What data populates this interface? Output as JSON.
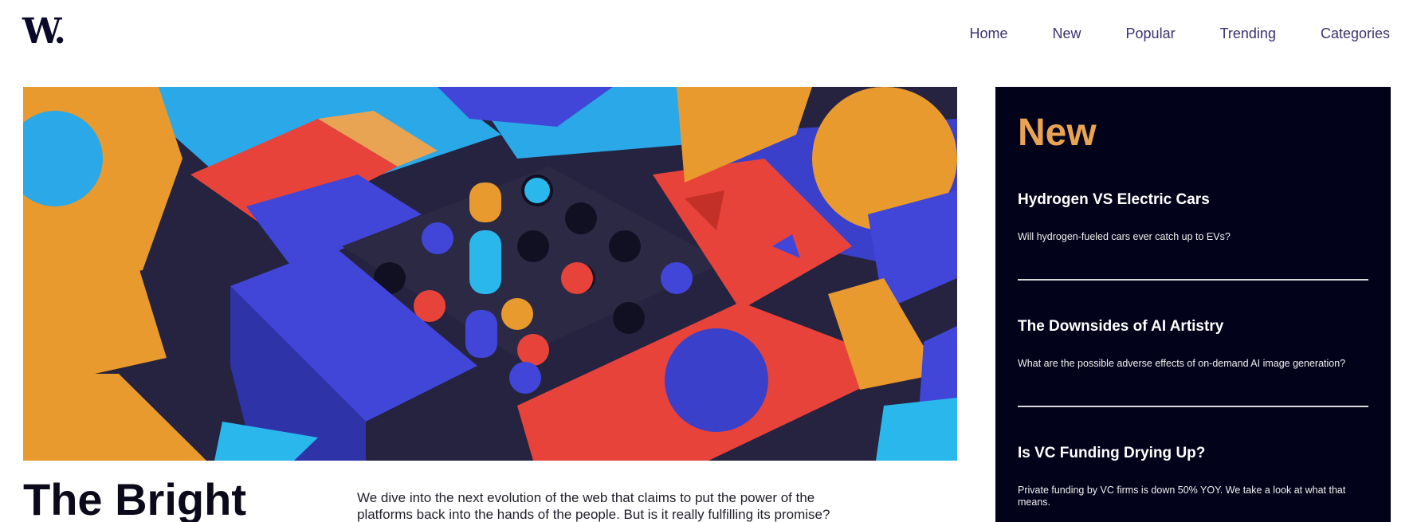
{
  "brand": {
    "logo_text": "W."
  },
  "nav": {
    "items": [
      {
        "label": "Home"
      },
      {
        "label": "New"
      },
      {
        "label": "Popular"
      },
      {
        "label": "Trending"
      },
      {
        "label": "Categories"
      }
    ]
  },
  "article": {
    "headline": "The Bright",
    "intro": "We dive into the next evolution of the web that claims to put the power of the platforms back into the hands of the people. But is it really fulfilling its promise?"
  },
  "sidebar": {
    "title": "New",
    "items": [
      {
        "title": "Hydrogen VS Electric Cars",
        "description": "Will hydrogen-fueled cars ever catch up to EVs?"
      },
      {
        "title": "The Downsides of AI Artistry",
        "description": "What are the possible adverse effects of on-demand AI image generation?"
      },
      {
        "title": "Is VC Funding Drying Up?",
        "description": "Private funding by VC firms is down 50% YOY. We take a look at what that means."
      }
    ]
  },
  "colors": {
    "accent_orange": "#e8a453",
    "sidebar_bg": "#03021b",
    "nav_text": "#3b3170",
    "logo": "#0b0a2a"
  }
}
